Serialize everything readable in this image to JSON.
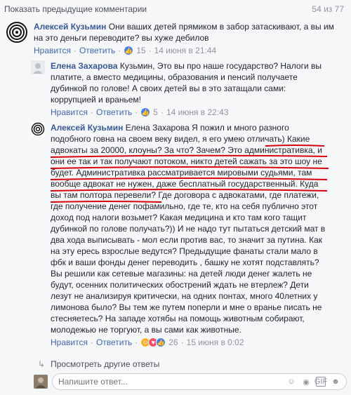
{
  "top": {
    "show_previous": "Показать предыдущие комментарии",
    "count": "54 из 77"
  },
  "comments": [
    {
      "author": "Алексей Кузьмин",
      "text_lines": [
        "Они ваших детей прямиком в забор затаскивают, а вы им",
        "на это деньги переводите? вы хуже дебилов"
      ],
      "like_label": "Нравится",
      "reply_label": "Ответить",
      "reactions": "15",
      "time": "14 июня в 21:44"
    },
    {
      "author": "Елена Захарова",
      "text_lines": [
        "Кузьмин, Это вы про наше государство? Налоги вы",
        "платите, а вместо медицины, образования и пенсий получаете",
        "дубинкой по голове! А своих детей вы в это затащали сами:",
        "коррупцией и враньем!"
      ],
      "like_label": "Нравится",
      "reply_label": "Ответить",
      "reactions": "5",
      "time": "14 июня в 22:43"
    },
    {
      "author": "Алексей Кузьмин",
      "text_lines": [
        "Елена Захарова Я пожил и много разного",
        "подобного говна на своем веку видел, я его умею отличать) Какие",
        "адвокаты за 20000, клоуны? За что? Зачем? Это административка, и",
        "они ее так и так получают потоком, никто детей сажать за это шоу не",
        "будет. Административка рассматривается мировыми судьями, там",
        "вообще адвокат не нужен, даже бесплатный государственный. Куда",
        "вы там полтора перевели? Где договора с адвокатами, где платежи,",
        "где получение денег пофамильно, где те, кто на себя публично этот",
        "доход под налоги возьмет? Какая медицина и кто там кого тащит",
        "дубинкой по голове получать?)) И не надо тут пытаться детский мат в",
        "два хода выписывать - мол если против вас, то значит за путина. Как",
        "на эту ересь взрослые ведутся? Предыдущие фанаты стали мало в",
        "фбк и ваши фонды денег переводить , башку не хотят подставлять?",
        "Вы решили как сетевые магазины: на детей люди денег жалеть не",
        "будут, осенних политических обострений ждать не втерлеж? Дети",
        "лезут не анализируя критически, на одних понтах, много 40летних у",
        "лимонова было? Вы тем же путем поперли и мне о вранье писать не",
        "стесняетесь? На западе хотябы на помощь животным собирают,",
        "молодежью не торгуют, а вы сами как животные."
      ],
      "like_label": "Нравится",
      "reply_label": "Ответить",
      "reactions": "26",
      "time": "15 июня в 0:02"
    }
  ],
  "more_replies": "Просмотреть другие ответы",
  "composer": {
    "placeholder": "Напишите ответ..."
  },
  "colors": {
    "link": "#4267b2",
    "name": "#365899",
    "underline": "#d9000d"
  }
}
